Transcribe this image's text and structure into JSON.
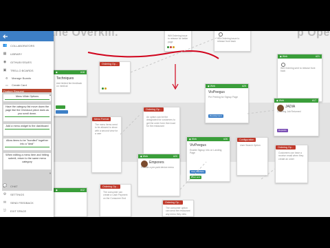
{
  "board": {
    "heading_left": "the Overkill.",
    "heading_right": "p Ope"
  },
  "sidebar": {
    "back_icon": "arrow-left-icon",
    "items": [
      {
        "label": "COLLABORATORS",
        "icon": "people-icon"
      },
      {
        "label": "LIBRARY",
        "icon": "library-icon"
      },
      {
        "label": "GITHUB ISSUES",
        "icon": "github-icon"
      },
      {
        "label": "TRELLO BOARDS",
        "icon": "trello-icon"
      }
    ],
    "sub_items": [
      {
        "label": "Manage Boards",
        "icon": "gear-icon"
      },
      {
        "label": "Create Card",
        "icon": "card-icon"
      }
    ],
    "feature_request": {
      "heading": "Feature Request",
      "items": [
        "Menu Wide Options",
        "Have the category list move down the page like the Checkout piece does as you scroll down.",
        "Add a menu widget to the dashboard",
        "Allow items to be \"bundled\" together into a \"deal\"",
        "When editing a menu item and hitting submit, return to the same menu category"
      ]
    },
    "bottom_items": [
      {
        "label": "CHAT",
        "icon": "chat-icon"
      },
      {
        "label": "SETTINGS",
        "icon": "gear-icon"
      },
      {
        "label": "SEND FEEDBACK",
        "icon": "feedback-icon"
      },
      {
        "label": "EXIT SPACE",
        "icon": "exit-icon"
      }
    ]
  },
  "cards": {
    "c1": {
      "bar": "#18",
      "title": "Techniques",
      "body": "Add limited fee feedback on medical"
    },
    "c2": {
      "chip": "Ordering Op..."
    },
    "c3": {
      "bar": "#19",
      "title": "",
      "body": "Will Ordering issue to release for better page"
    },
    "c4": {
      "chip": "Ordering Op...",
      "body": "Will Ordering issue to release front back"
    },
    "c5": {
      "bar": "#21",
      "title": "",
      "body": "Will Ordering sent to release front back"
    },
    "c6": {
      "chip": "Menu Format",
      "body": "The menu items need to be allowed to show with a second view for a user"
    },
    "c7": {
      "chip": "Ordering Op...",
      "body": "An option can be the designated for customers to get the order form then load for the restaurant"
    },
    "c8": {
      "bar": "#29",
      "title": "VivPeegus",
      "body": "Pre Printing for Signup Page",
      "pill": "Development"
    },
    "c9": {
      "bar": "#17",
      "title": "JADIA",
      "body": "Ordering Job Returned",
      "pill": "Deposits"
    },
    "c10": {
      "bar": "#20",
      "title": "Emporers",
      "body": "Provide a pre-paid device menu"
    },
    "c11": {
      "bar": "#26",
      "title": "VivPeegus",
      "body": "Enable Signup Info on Landing Page",
      "pill1": "User Interface",
      "pill2": "Front end"
    },
    "c12": {
      "chip": "Configuration",
      "body": "User Search Option"
    },
    "c13": {
      "chip": "Ordering Op...",
      "body": "Customers can have a receive email when they create an order"
    },
    "c14": {
      "chip": "Ordering Op...",
      "body": "The consumer can create a Cash Payment on the Consumer End"
    },
    "c15": {
      "chip": "Ordering Op...",
      "body": "The consumer option can send the restaurant any menu they view"
    },
    "c16": {
      "bar": "#12",
      "title": "",
      "body": ""
    }
  }
}
